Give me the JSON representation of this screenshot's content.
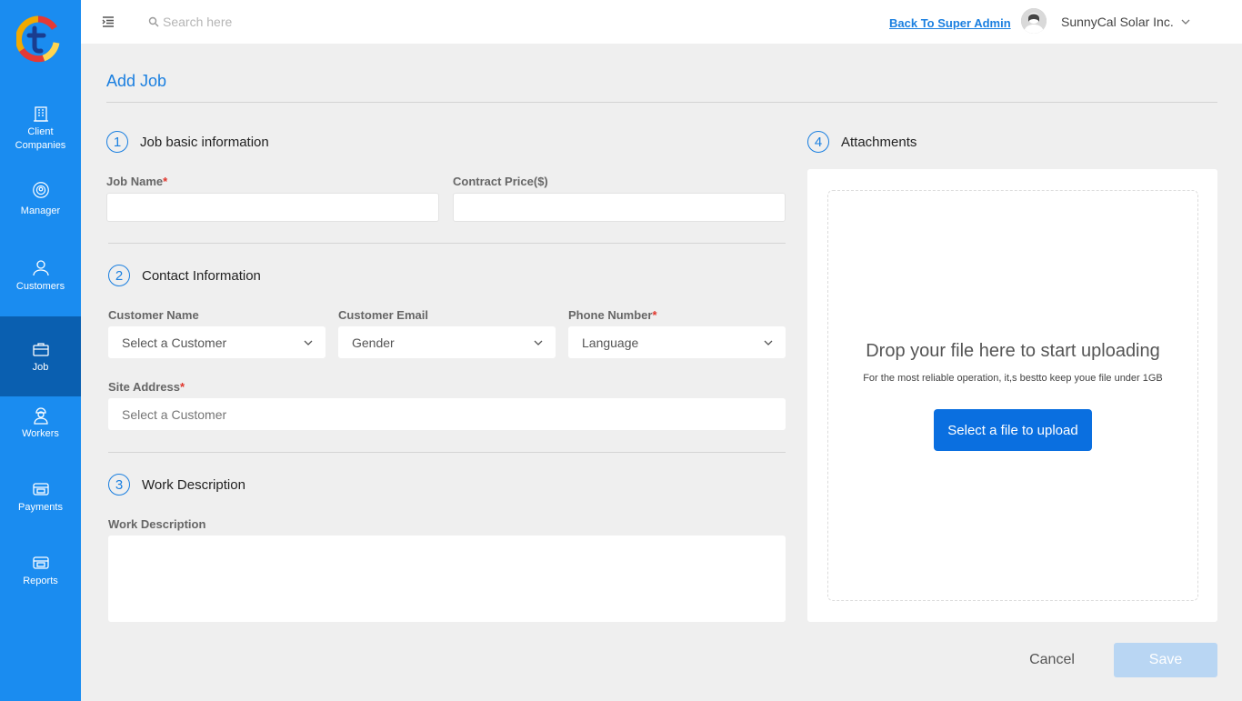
{
  "sidebar": {
    "logo_icon": "t-logo-icon",
    "items": [
      {
        "label": "Client\nCompanies",
        "icon": "building-icon"
      },
      {
        "label": "Manager",
        "icon": "gear-icon"
      },
      {
        "label": "Customers",
        "icon": "user-icon"
      },
      {
        "label": "Job",
        "icon": "briefcase-icon",
        "active": true
      },
      {
        "label": "Workers",
        "icon": "worker-icon"
      },
      {
        "label": "Payments",
        "icon": "payment-icon"
      },
      {
        "label": "Reports",
        "icon": "report-icon"
      }
    ],
    "accent": "#1a8cf0",
    "active_color": "#0a5fb0"
  },
  "topbar": {
    "search_placeholder": "Search here",
    "back_link": "Back To Super Admin",
    "company_name": "SunnyCal Solar Inc."
  },
  "page": {
    "title": "Add Job"
  },
  "section1": {
    "num": "1",
    "title": "Job basic information",
    "job_name_label": "Job Name",
    "contract_price_label": "Contract Price($)",
    "required_mark": "*"
  },
  "section2": {
    "num": "2",
    "title": "Contact Information",
    "customer_name_label": "Customer Name",
    "customer_name_value": "Select a Customer",
    "customer_email_label": "Customer Email",
    "customer_email_value": "Gender",
    "phone_label": "Phone Number",
    "phone_value": "Language",
    "site_address_label": "Site Address",
    "site_address_placeholder": "Select a Customer"
  },
  "section3": {
    "num": "3",
    "title": "Work Description",
    "work_desc_label": "Work Description"
  },
  "section4": {
    "num": "4",
    "title": "Attachments",
    "drop_title": "Drop your file here to start uploading",
    "drop_sub": "For the most reliable operation, it,s bestto keep youe file under  1GB",
    "upload_label": "Select a file to upload"
  },
  "actions": {
    "cancel": "Cancel",
    "save": "Save"
  }
}
